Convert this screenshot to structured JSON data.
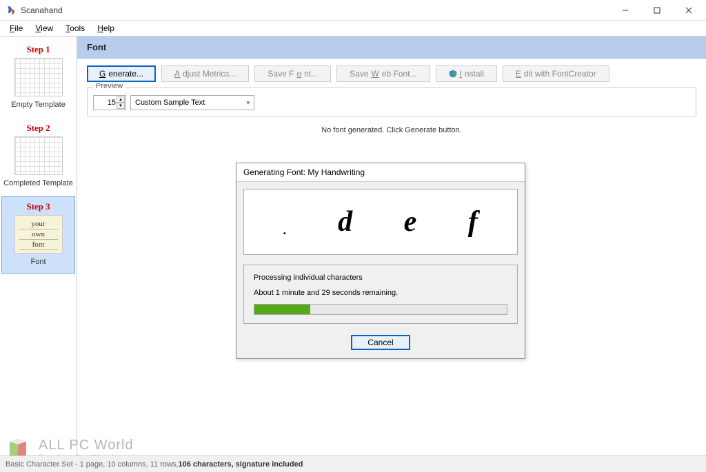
{
  "window": {
    "title": "Scanahand"
  },
  "menu": {
    "file": "File",
    "view": "View",
    "tools": "Tools",
    "help": "Help"
  },
  "sidebar": {
    "steps": [
      {
        "title": "Step 1",
        "label": "Empty Template"
      },
      {
        "title": "Step 2",
        "label": "Completed Template"
      },
      {
        "title": "Step 3",
        "label": "Font",
        "thumb_lines": [
          "your",
          "own",
          "font"
        ]
      }
    ]
  },
  "section": {
    "title": "Font"
  },
  "toolbar": {
    "generate": "Generate...",
    "adjust_metrics": "Adjust Metrics...",
    "save_font": "Save Font...",
    "save_web_font": "Save Web Font...",
    "install": "Install",
    "edit_with": "Edit with FontCreator"
  },
  "preview": {
    "legend": "Preview",
    "size": "15",
    "sample": "Custom Sample Text",
    "no_font": "No font generated. Click Generate button."
  },
  "dialog": {
    "title": "Generating Font: My Handwriting",
    "glyphs": [
      ".",
      "d",
      "e",
      "f"
    ],
    "status": "Processing individual characters",
    "remaining": "About 1 minute and 29 seconds remaining.",
    "progress_pct": 22,
    "cancel": "Cancel"
  },
  "status": {
    "prefix": "Basic Character Set - 1 page, 10 columns, 11 rows, ",
    "bold": "106 characters, signature included"
  },
  "watermark": {
    "title": "ALL PC World",
    "sub": "Free Apps One Click Away"
  }
}
